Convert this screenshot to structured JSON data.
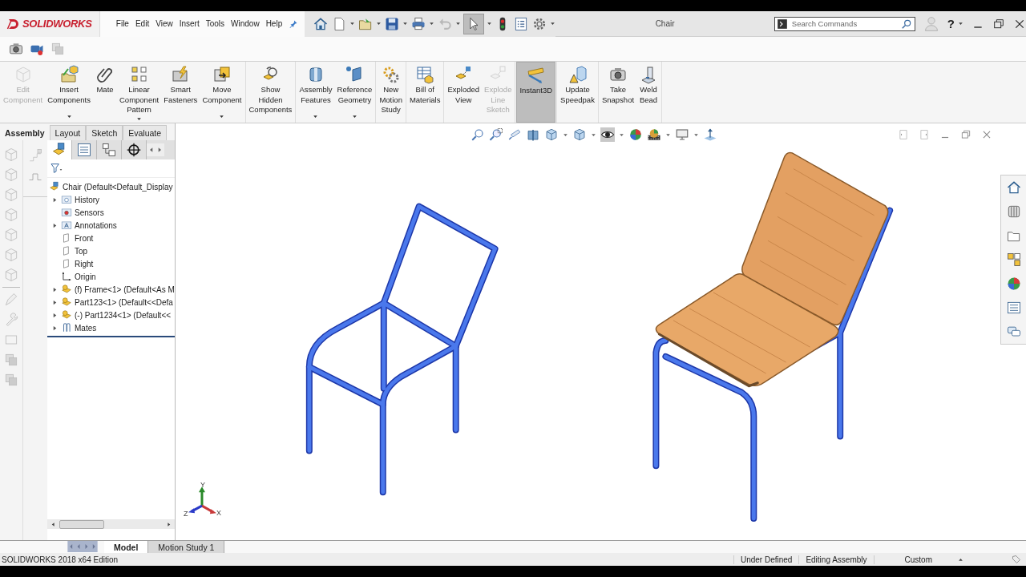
{
  "app": {
    "logo": "SOLIDWORKS",
    "menu": [
      "File",
      "Edit",
      "View",
      "Insert",
      "Tools",
      "Window",
      "Help"
    ],
    "title": "Chair",
    "search": {
      "placeholder": "Search Commands"
    },
    "help": "?"
  },
  "ribbon": {
    "groups": [
      {
        "commands": [
          {
            "label": "Edit\nComponent",
            "disabled": true,
            "dropdown": false,
            "selected": false
          },
          {
            "label": "Insert\nComponents",
            "disabled": false,
            "dropdown": true,
            "selected": false
          },
          {
            "label": "Mate",
            "disabled": false,
            "dropdown": false,
            "selected": false
          },
          {
            "label": "Linear\nComponent\nPattern",
            "disabled": false,
            "dropdown": true,
            "selected": false
          },
          {
            "label": "Smart\nFasteners",
            "disabled": false,
            "dropdown": false,
            "selected": false
          },
          {
            "label": "Move\nComponent",
            "disabled": false,
            "dropdown": true,
            "selected": false
          }
        ]
      },
      {
        "commands": [
          {
            "label": "Show\nHidden\nComponents",
            "disabled": false,
            "dropdown": false,
            "selected": false
          }
        ]
      },
      {
        "commands": [
          {
            "label": "Assembly\nFeatures",
            "disabled": false,
            "dropdown": true,
            "selected": false
          },
          {
            "label": "Reference\nGeometry",
            "disabled": false,
            "dropdown": true,
            "selected": false
          }
        ]
      },
      {
        "commands": [
          {
            "label": "New\nMotion\nStudy",
            "disabled": false,
            "dropdown": false,
            "selected": false
          }
        ]
      },
      {
        "commands": [
          {
            "label": "Bill of\nMaterials",
            "disabled": false,
            "dropdown": false,
            "selected": false
          }
        ]
      },
      {
        "commands": [
          {
            "label": "Exploded\nView",
            "disabled": false,
            "dropdown": false,
            "selected": false
          },
          {
            "label": "Explode\nLine\nSketch",
            "disabled": true,
            "dropdown": false,
            "selected": false
          }
        ]
      },
      {
        "commands": [
          {
            "label": "Instant3D",
            "disabled": false,
            "dropdown": false,
            "selected": true
          }
        ]
      },
      {
        "commands": [
          {
            "label": "Update\nSpeedpak",
            "disabled": false,
            "dropdown": false,
            "selected": false
          }
        ]
      },
      {
        "commands": [
          {
            "label": "Take\nSnapshot",
            "disabled": false,
            "dropdown": false,
            "selected": false
          },
          {
            "label": "Weld\nBead",
            "disabled": false,
            "dropdown": false,
            "selected": false
          }
        ]
      }
    ]
  },
  "command_tabs": [
    {
      "label": "Assembly",
      "selected": true
    },
    {
      "label": "Layout",
      "selected": false
    },
    {
      "label": "Sketch",
      "selected": false
    },
    {
      "label": "Evaluate",
      "selected": false
    }
  ],
  "feature_tree": {
    "panel_tabs": [
      {
        "selected": true
      },
      {
        "selected": false
      },
      {
        "selected": false
      },
      {
        "selected": false
      }
    ],
    "root": {
      "label": "Chair  (Default<Default_Display",
      "children": [
        {
          "label": "History",
          "kind": "folder",
          "has_children": true
        },
        {
          "label": "Sensors",
          "kind": "sensor",
          "has_children": false
        },
        {
          "label": "Annotations",
          "kind": "annotation",
          "has_children": true
        },
        {
          "label": "Front",
          "kind": "plane",
          "has_children": false
        },
        {
          "label": "Top",
          "kind": "plane",
          "has_children": false
        },
        {
          "label": "Right",
          "kind": "plane",
          "has_children": false
        },
        {
          "label": "Origin",
          "kind": "origin",
          "has_children": false
        },
        {
          "label": "(f) Frame<1> (Default<As M",
          "kind": "part",
          "has_children": true
        },
        {
          "label": "Part123<1> (Default<<Defa",
          "kind": "part",
          "has_children": true
        },
        {
          "label": "(-) Part1234<1> (Default<<",
          "kind": "part",
          "has_children": true
        },
        {
          "label": "Mates",
          "kind": "mates",
          "has_children": true
        }
      ]
    }
  },
  "triad": {
    "x": "X",
    "y": "Y",
    "z": "Z"
  },
  "bottom_tabs": [
    {
      "label": "Model",
      "selected": true
    },
    {
      "label": "Motion Study 1",
      "selected": false
    }
  ],
  "status_bar": {
    "product": "SOLIDWORKS 2018 x64 Edition",
    "state": "Under Defined",
    "mode": "Editing Assembly",
    "units": "Custom"
  }
}
